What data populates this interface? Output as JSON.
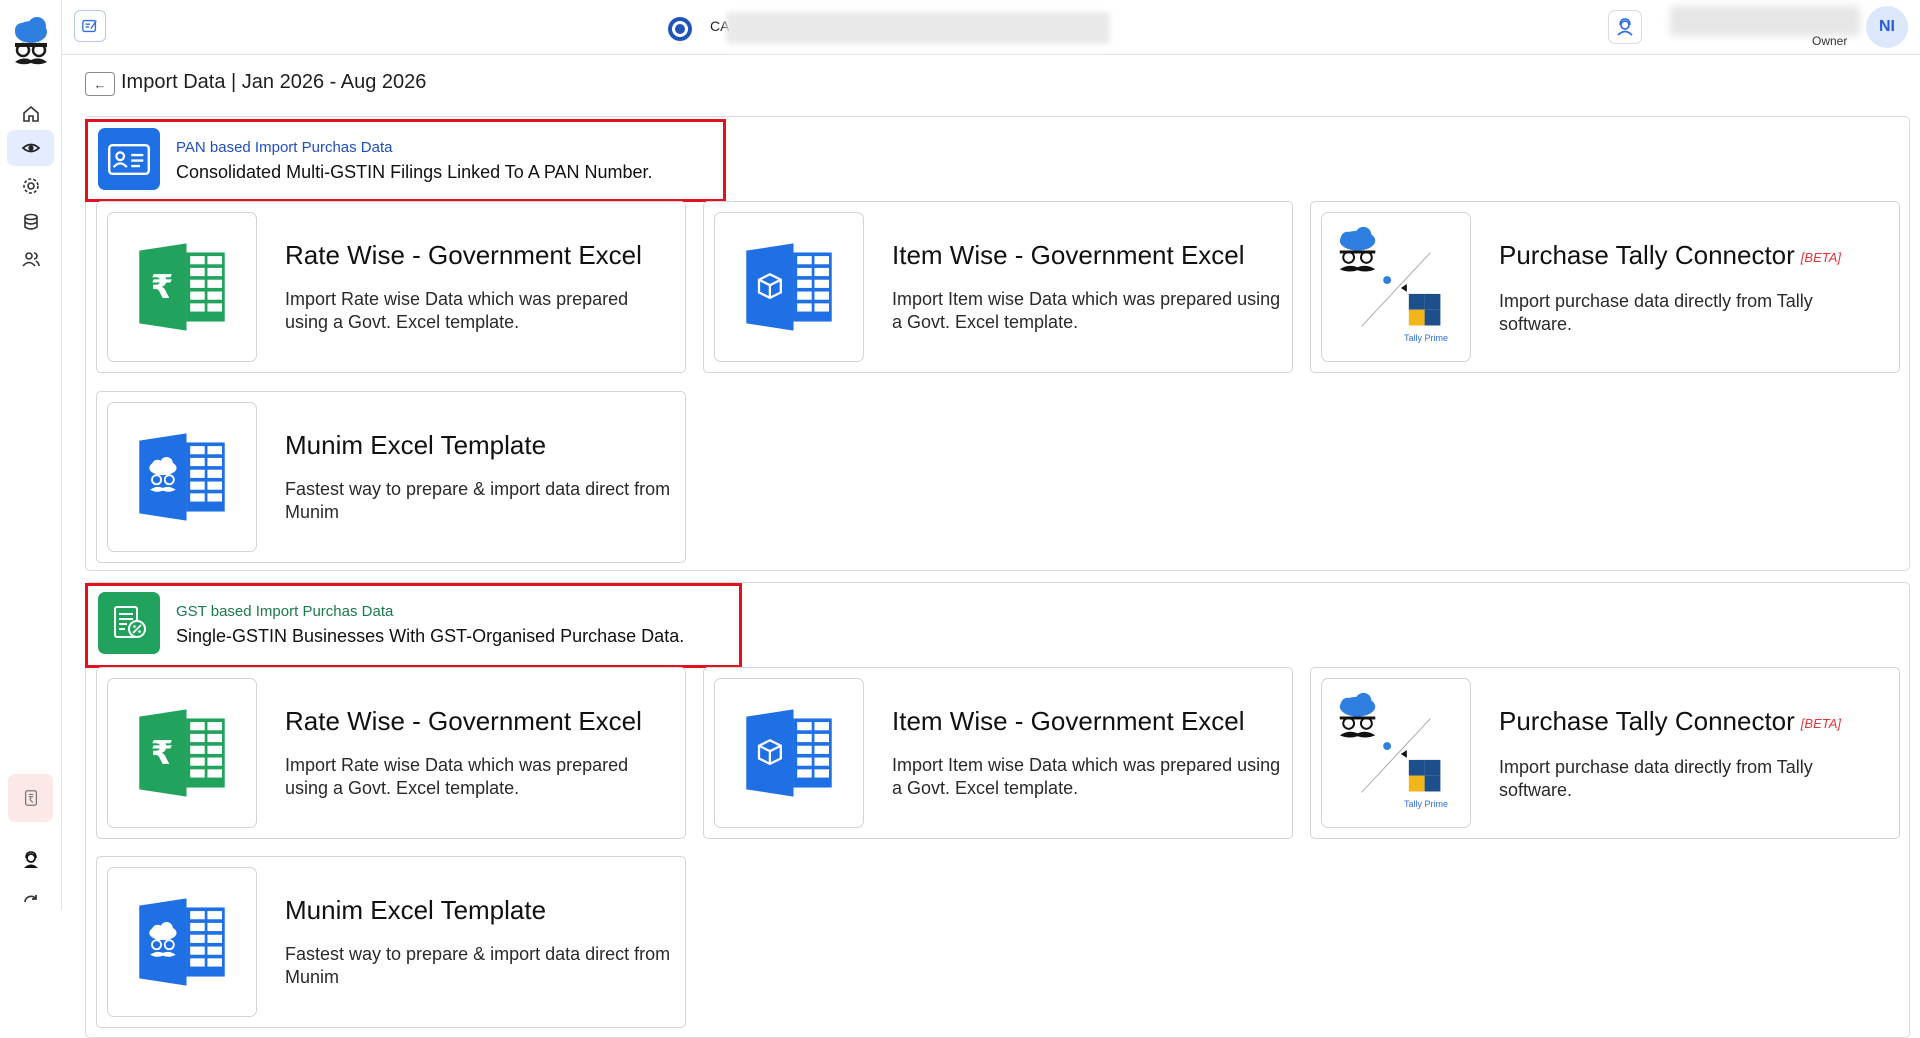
{
  "header": {
    "company_prefix": "CA",
    "role": "Owner",
    "avatar_initials": "NI"
  },
  "page": {
    "back_symbol": "←",
    "title": "Import Data | Jan 2026 - Aug 2026"
  },
  "sections": [
    {
      "title": "PAN based Import Purchas Data",
      "description": "Consolidated Multi-GSTIN Filings Linked To A PAN Number.",
      "title_color": "#1f4fbf",
      "icon": "id-card-icon",
      "cards": [
        {
          "title": "Rate Wise - Government Excel",
          "beta": "",
          "description": "Import Rate wise Data which was prepared using a Govt. Excel template."
        },
        {
          "title": "Item Wise - Government Excel",
          "beta": "",
          "description": "Import Item wise Data which was prepared using a Govt. Excel template."
        },
        {
          "title": "Purchase Tally Connector",
          "beta": "[BETA]",
          "description": "Import purchase data directly from Tally software.",
          "thumb_caption": "Tally Prime"
        },
        {
          "title": "Munim Excel Template",
          "beta": "",
          "description": "Fastest way to prepare & import data direct from Munim"
        }
      ]
    },
    {
      "title": "GST based Import Purchas Data",
      "description": "Single-GSTIN Businesses With GST-Organised Purchase Data.",
      "title_color": "#1a7a4c",
      "icon": "gst-document-icon",
      "cards": [
        {
          "title": "Rate Wise - Government Excel",
          "beta": "",
          "description": "Import Rate wise Data which was prepared using a Govt. Excel template."
        },
        {
          "title": "Item Wise - Government Excel",
          "beta": "",
          "description": "Import Item wise Data which was prepared using a Govt. Excel template."
        },
        {
          "title": "Purchase Tally Connector",
          "beta": "[BETA]",
          "description": "Import purchase data directly from Tally software.",
          "thumb_caption": "Tally Prime"
        },
        {
          "title": "Munim Excel Template",
          "beta": "",
          "description": "Fastest way to prepare & import data direct from Munim"
        }
      ]
    }
  ],
  "colors": {
    "accent_blue": "#1f6fe5",
    "excel_green": "#21a35e",
    "highlight_red": "#e3101e"
  }
}
